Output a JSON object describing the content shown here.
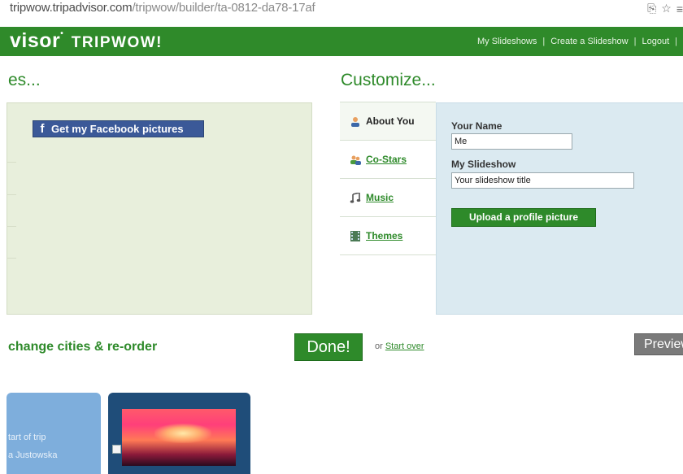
{
  "browser": {
    "url_host": "tripwow.tripadvisor.com",
    "url_path": "/tripwow/builder/ta-0812-da78-17af"
  },
  "header": {
    "logo_main": "visor",
    "logo_sub": "TRIPWOW!",
    "nav": [
      "My Slideshows",
      "Create a Slideshow",
      "Logout"
    ]
  },
  "left": {
    "heading": "es...",
    "facebook_button": "Get my Facebook pictures"
  },
  "customize": {
    "heading": "Customize...",
    "tabs": [
      {
        "label": "About You",
        "active": true
      },
      {
        "label": "Co-Stars",
        "active": false
      },
      {
        "label": "Music",
        "active": false
      },
      {
        "label": "Themes",
        "active": false
      }
    ],
    "name_label": "Your Name",
    "name_value": "Me",
    "slideshow_label": "My Slideshow",
    "slideshow_value": "Your slideshow title",
    "upload_button": "Upload a profile picture"
  },
  "footer": {
    "change_text": "change cities & re-order",
    "done_button": "Done!",
    "or_prefix": "or",
    "start_over": "Start over",
    "preview_button": "Preview"
  },
  "cards": {
    "start_line1": "tart of trip",
    "start_line2": "a Justowska"
  },
  "colors": {
    "brand_green": "#2f8a2a",
    "facebook_blue": "#3b5998",
    "panel_green": "#e8efdc",
    "panel_blue": "#dbeaf1"
  }
}
